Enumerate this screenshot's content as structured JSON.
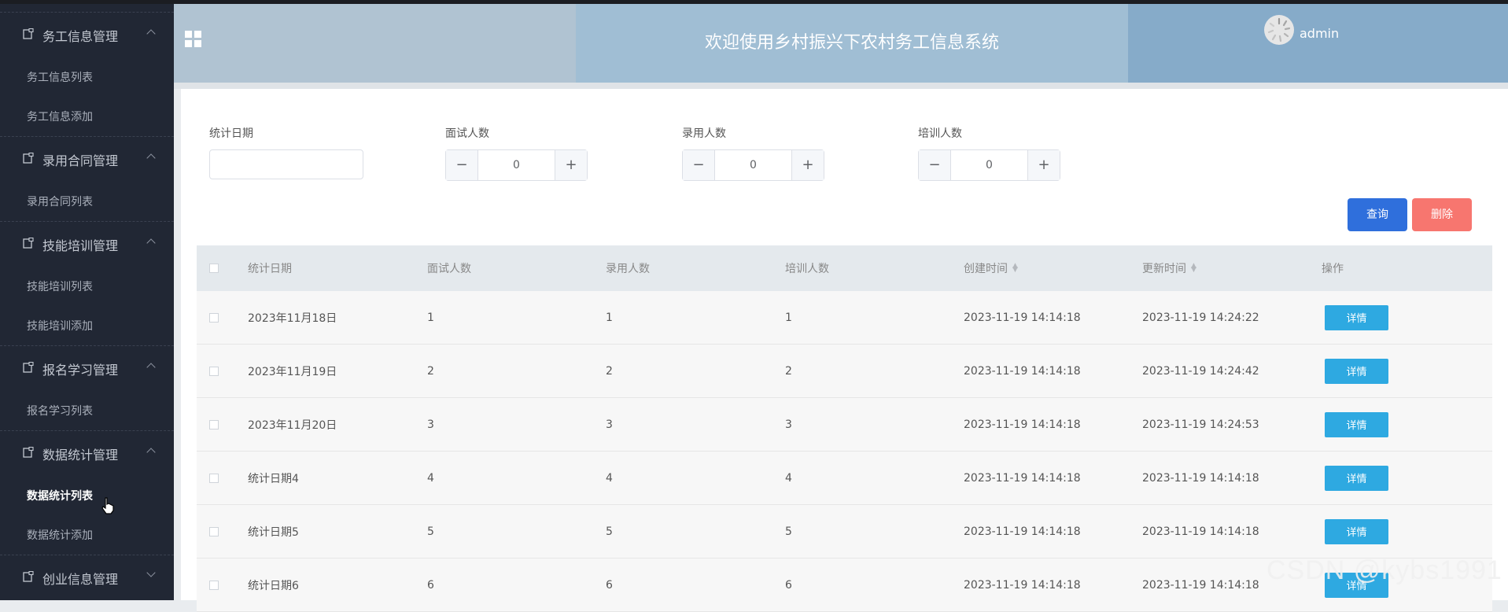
{
  "app": {
    "title": "欢迎使用乡村振兴下农村务工信息系统",
    "user": "admin"
  },
  "sidebar": {
    "groups": [
      {
        "label": "务工信息管理",
        "items": [
          "务工信息列表",
          "务工信息添加"
        ]
      },
      {
        "label": "录用合同管理",
        "items": [
          "录用合同列表"
        ]
      },
      {
        "label": "技能培训管理",
        "items": [
          "技能培训列表",
          "技能培训添加"
        ]
      },
      {
        "label": "报名学习管理",
        "items": [
          "报名学习列表"
        ]
      },
      {
        "label": "数据统计管理",
        "items": [
          "数据统计列表",
          "数据统计添加"
        ]
      },
      {
        "label": "创业信息管理",
        "items": []
      }
    ],
    "active_item": "数据统计列表"
  },
  "filters": {
    "date_label": "统计日期",
    "date_value": "",
    "interview_label": "面试人数",
    "interview_value": "0",
    "hire_label": "录用人数",
    "hire_value": "0",
    "train_label": "培训人数",
    "train_value": "0",
    "minus": "−",
    "plus": "+"
  },
  "actions": {
    "query": "查询",
    "delete": "删除"
  },
  "table": {
    "columns": [
      "统计日期",
      "面试人数",
      "录用人数",
      "培训人数",
      "创建时间",
      "更新时间",
      "操作"
    ],
    "rows": [
      [
        "2023年11月18日",
        "1",
        "1",
        "1",
        "2023-11-19 14:14:18",
        "2023-11-19 14:24:22"
      ],
      [
        "2023年11月19日",
        "2",
        "2",
        "2",
        "2023-11-19 14:14:18",
        "2023-11-19 14:24:42"
      ],
      [
        "2023年11月20日",
        "3",
        "3",
        "3",
        "2023-11-19 14:14:18",
        "2023-11-19 14:24:53"
      ],
      [
        "统计日期4",
        "4",
        "4",
        "4",
        "2023-11-19 14:14:18",
        "2023-11-19 14:14:18"
      ],
      [
        "统计日期5",
        "5",
        "5",
        "5",
        "2023-11-19 14:14:18",
        "2023-11-19 14:14:18"
      ],
      [
        "统计日期6",
        "6",
        "6",
        "6",
        "2023-11-19 14:14:18",
        "2023-11-19 14:14:18"
      ]
    ],
    "detail_label": "详情"
  },
  "watermark": "CSDN @kybs1991",
  "colors": {
    "sidebar": "#212734",
    "query": "#2f6fdc",
    "delete": "#f7766f",
    "detail": "#2ea9e1"
  }
}
